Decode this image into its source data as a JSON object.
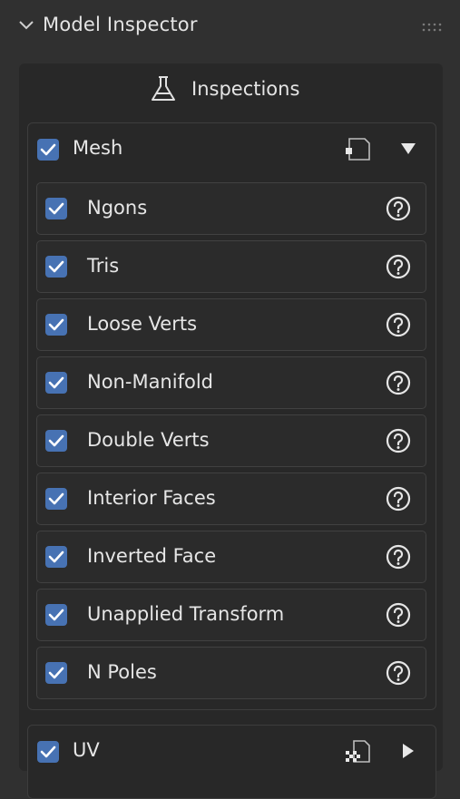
{
  "header": {
    "title": "Model Inspector"
  },
  "panel": {
    "title": "Inspections"
  },
  "mesh_group": {
    "label": "Mesh",
    "checked": true,
    "items": [
      {
        "label": "Ngons",
        "checked": true
      },
      {
        "label": "Tris",
        "checked": true
      },
      {
        "label": "Loose Verts",
        "checked": true
      },
      {
        "label": "Non-Manifold",
        "checked": true
      },
      {
        "label": "Double Verts",
        "checked": true
      },
      {
        "label": "Interior Faces",
        "checked": true
      },
      {
        "label": "Inverted Face",
        "checked": true
      },
      {
        "label": "Unapplied Transform",
        "checked": true
      },
      {
        "label": "N Poles",
        "checked": true
      }
    ]
  },
  "uv_group": {
    "label": "UV",
    "checked": true
  },
  "colors": {
    "accent": "#4772b3",
    "background": "#303030",
    "panel": "#282828"
  },
  "icons": [
    "chevron-down-icon",
    "drag-grip-icon",
    "flask-icon",
    "mesh-mode-icon",
    "collapse-arrow-icon",
    "help-icon",
    "uv-checker-icon",
    "expand-arrow-icon"
  ]
}
